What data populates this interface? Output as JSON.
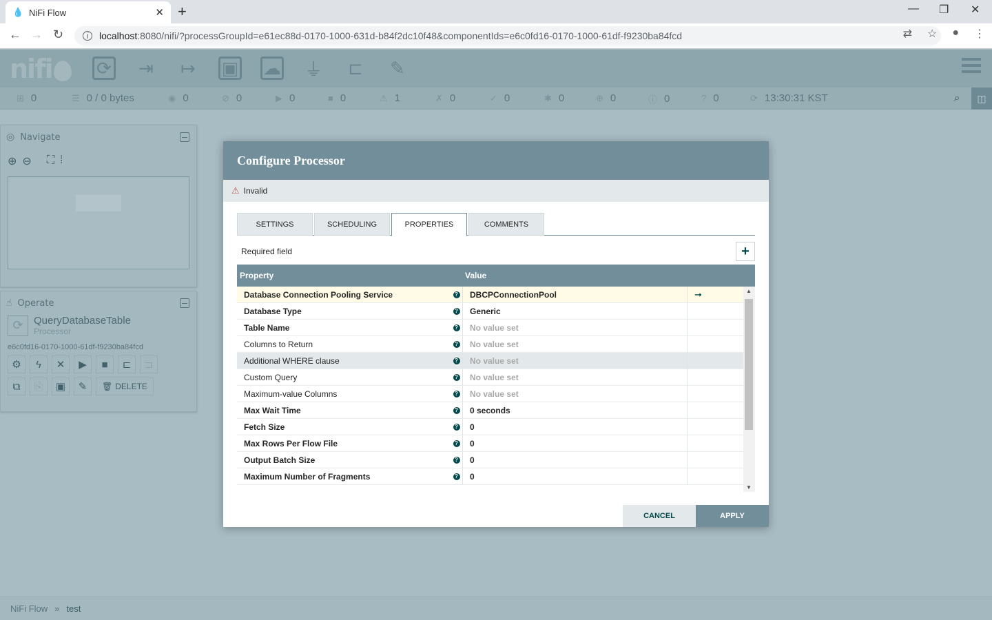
{
  "browser": {
    "tab_title": "NiFi Flow",
    "url_host": "localhost",
    "url_rest": ":8080/nifi/?processGroupId=e61ec88d-0170-1000-631d-b84f2dc10f48&componentIds=e6c0fd16-0170-1000-61df-f9230ba84fcd"
  },
  "status": {
    "active_threads": "0",
    "queued": "0 / 0 bytes",
    "transmitting": "0",
    "not_transmitting": "0",
    "running": "0",
    "stopped": "0",
    "invalid": "1",
    "disabled": "0",
    "up_to_date": "0",
    "locally_modified": "0",
    "stale": "0",
    "locally_modified_stale": "0",
    "sync_failure": "0",
    "refresh_time": "13:30:31 KST"
  },
  "navigate": {
    "title": "Navigate"
  },
  "operate": {
    "title": "Operate",
    "component_name": "QueryDatabaseTable",
    "component_type": "Processor",
    "component_id": "e6c0fd16-0170-1000-61df-f9230ba84fcd",
    "delete_label": "DELETE"
  },
  "breadcrumb": {
    "root": "NiFi Flow",
    "sep": "»",
    "current": "test"
  },
  "dialog": {
    "title": "Configure Processor",
    "validity": "Invalid",
    "tabs": [
      "SETTINGS",
      "SCHEDULING",
      "PROPERTIES",
      "COMMENTS"
    ],
    "required_field": "Required field",
    "add_label": "+",
    "col_property": "Property",
    "col_value": "Value",
    "properties": [
      {
        "name": "Database Connection Pooling Service",
        "value": "DBCPConnectionPool"
      },
      {
        "name": "Database Type",
        "value": "Generic"
      },
      {
        "name": "Table Name",
        "value": "No value set"
      },
      {
        "name": "Columns to Return",
        "value": "No value set"
      },
      {
        "name": "Additional WHERE clause",
        "value": "No value set"
      },
      {
        "name": "Custom Query",
        "value": "No value set"
      },
      {
        "name": "Maximum-value Columns",
        "value": "No value set"
      },
      {
        "name": "Max Wait Time",
        "value": "0 seconds"
      },
      {
        "name": "Fetch Size",
        "value": "0"
      },
      {
        "name": "Max Rows Per Flow File",
        "value": "0"
      },
      {
        "name": "Output Batch Size",
        "value": "0"
      },
      {
        "name": "Maximum Number of Fragments",
        "value": "0"
      }
    ],
    "cancel_label": "CANCEL",
    "apply_label": "APPLY"
  }
}
